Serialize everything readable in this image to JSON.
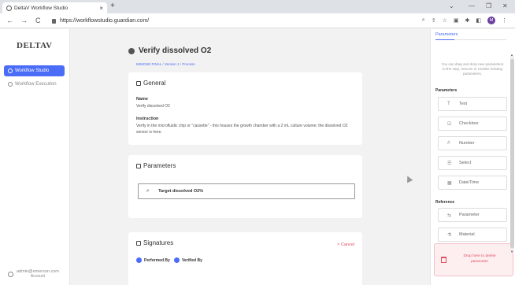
{
  "browser": {
    "tab_title": "DeltaV Workflow Studio",
    "tab_close": "×",
    "new_tab": "+",
    "url": "https://workflowstudio.guardian.com/",
    "profile_initial": "M",
    "controls": {
      "minimize": "—",
      "maximize": "❐",
      "close": "✕",
      "dropdown": "⌄"
    },
    "nav": {
      "back": "←",
      "forward": "→",
      "reload": "C"
    }
  },
  "sidebar": {
    "logo": "DELTAV",
    "items": [
      {
        "label": "Workflow Studio",
        "active": true
      },
      {
        "label": "Workflow Execution",
        "active": false
      }
    ],
    "account": {
      "email": "admin@emerson.com",
      "role": "Account"
    }
  },
  "main": {
    "title": "Verify dissolved O2",
    "breadcrumb": {
      "workflow": "IMMOSE FINAL",
      "version": "Version 1",
      "current": "Process",
      "sep": " / "
    },
    "general": {
      "heading": "General",
      "name_label": "Name",
      "name_value": "Verify dissolved O2",
      "instruction_label": "Instruction",
      "instruction_value": "Verify in the microfluidic chip or \"cassette\" - this houses the growth chamber with a 2 mL culture volume; the dissolved O2 sensor is here."
    },
    "parameters": {
      "heading": "Parameters",
      "rows": [
        {
          "label": "Target dissolved O2%"
        }
      ]
    },
    "signatures": {
      "heading": "Signatures",
      "cancel_label": "Cancel",
      "items": [
        {
          "label": "Performed By"
        },
        {
          "label": "Verified By"
        }
      ]
    }
  },
  "right_panel": {
    "tab": "Parameters",
    "hint": "You can drag and drop new parameters to the step, remove or reorder existing parameters.",
    "sections": [
      {
        "title": "Parameters",
        "items": [
          {
            "label": "Text",
            "icon": "text-icon",
            "glyph": "T"
          },
          {
            "label": "Checkbox",
            "icon": "checkbox-icon",
            "glyph": "☑"
          },
          {
            "label": "Number",
            "icon": "number-icon",
            "glyph": "#"
          },
          {
            "label": "Select",
            "icon": "select-icon",
            "glyph": "☰"
          },
          {
            "label": "Date/Time",
            "icon": "calendar-icon",
            "glyph": "▦"
          }
        ]
      },
      {
        "title": "Reference",
        "items": [
          {
            "label": "Parameter",
            "icon": "parameter-icon",
            "glyph": "⇆"
          },
          {
            "label": "Material",
            "icon": "material-icon",
            "glyph": "⚗"
          }
        ]
      }
    ],
    "dropzone": "Drop here to delete parameter"
  }
}
